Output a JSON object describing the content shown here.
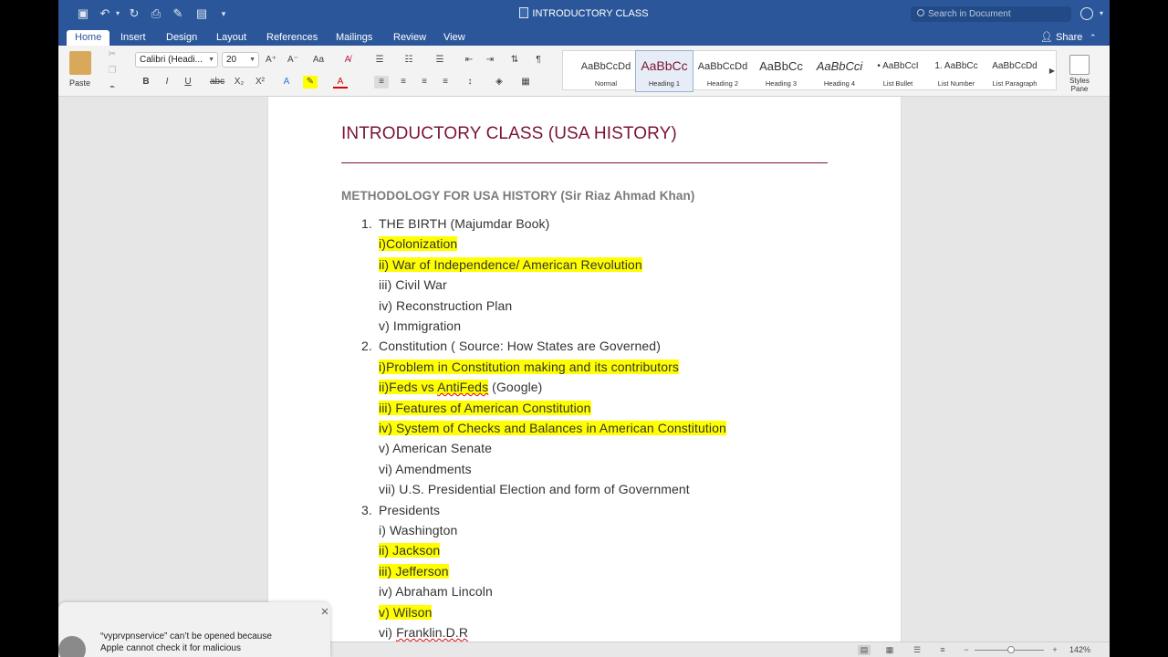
{
  "titlebar": {
    "title": "INTRODUCTORY CLASS",
    "search_placeholder": "Search in Document"
  },
  "tabs": [
    "Home",
    "Insert",
    "Design",
    "Layout",
    "References",
    "Mailings",
    "Review",
    "View"
  ],
  "share_label": "Share",
  "ribbon": {
    "paste_label": "Paste",
    "font_name": "Calibri (Headi...",
    "font_size": "20",
    "styles": [
      {
        "sample": "AaBbCcDd",
        "name": "Normal"
      },
      {
        "sample": "AaBbCc",
        "name": "Heading 1"
      },
      {
        "sample": "AaBbCcDd",
        "name": "Heading 2"
      },
      {
        "sample": "AaBbCc",
        "name": "Heading 3"
      },
      {
        "sample": "AaBbCci",
        "name": "Heading 4"
      },
      {
        "sample": "• AaBbCcI",
        "name": "List Bullet"
      },
      {
        "sample": "1. AaBbCc",
        "name": "List Number"
      },
      {
        "sample": "AaBbCcDd",
        "name": "List Paragraph"
      }
    ],
    "styles_pane_label": "Styles Pane"
  },
  "document": {
    "title": "INTRODUCTORY CLASS (USA HISTORY)",
    "subtitle": "METHODOLOGY FOR USA HISTORY (Sir Riaz Ahmad Khan)",
    "lines": [
      {
        "num": "1.",
        "text": "THE BIRTH (Majumdar Book)",
        "hl": false
      },
      {
        "num": "",
        "text": "i)Colonization",
        "hl": true
      },
      {
        "num": "",
        "text": "ii) War of Independence/ American Revolution",
        "hl": true
      },
      {
        "num": "",
        "text": "iii) Civil War",
        "hl": false
      },
      {
        "num": "",
        "text": "iv) Reconstruction Plan",
        "hl": false
      },
      {
        "num": "",
        "text": "v) Immigration",
        "hl": false
      },
      {
        "num": "2.",
        "text": "Constitution ( Source: How States are Governed)",
        "hl": false
      },
      {
        "num": "",
        "text": "i)Problem in Constitution making and its contributors",
        "hl": true
      },
      {
        "num": "",
        "text": "ii)Feds vs AntiFeds",
        "hl": true,
        "after": " (Google)"
      },
      {
        "num": "",
        "text": "iii) Features of American Constitution",
        "hl": true
      },
      {
        "num": "",
        "text": "iv) System of Checks and Balances in American Constitution",
        "hl": true
      },
      {
        "num": "",
        "text": "v) American Senate",
        "hl": false
      },
      {
        "num": "",
        "text": "vi) Amendments",
        "hl": false
      },
      {
        "num": "",
        "text": "vii) U.S. Presidential Election and form of Government",
        "hl": false
      },
      {
        "num": "3.",
        "text": "Presidents",
        "hl": false
      },
      {
        "num": "",
        "text": "i) Washington",
        "hl": false
      },
      {
        "num": "",
        "text": "ii) Jackson",
        "hl": true
      },
      {
        "num": "",
        "text": "iii) Jefferson",
        "hl": true
      },
      {
        "num": "",
        "text": "iv) Abraham Lincoln",
        "hl": false
      },
      {
        "num": "",
        "text": "v) Wilson",
        "hl": true
      },
      {
        "num": "",
        "text": "vi) Franklin.D.R",
        "hl": false
      }
    ]
  },
  "status": {
    "zoom": "142%"
  },
  "notification": {
    "line1": "“vyprvpnservice” can’t be opened because",
    "line2": "Apple cannot check it for malicious"
  },
  "colors": {
    "titlebar": "#2b579a",
    "heading": "#7a1333",
    "highlight": "#ffff00"
  }
}
